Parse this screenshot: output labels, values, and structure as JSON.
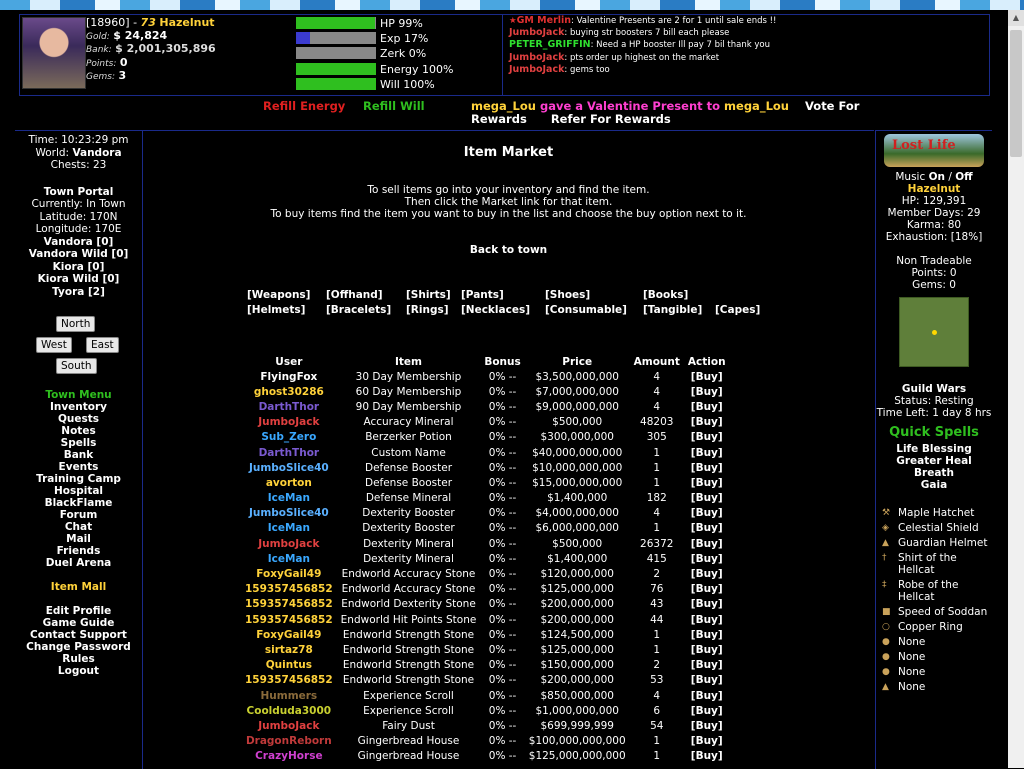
{
  "player": {
    "id": "[18960]",
    "sep": " - ",
    "level": "73",
    "name": "Hazelnut",
    "gold_label": "Gold:",
    "gold": "$ 24,824",
    "bank_label": "Bank:",
    "bank": "$ 2,001,305,896",
    "points_label": "Points:",
    "points": "0",
    "gems_label": "Gems:",
    "gems": "3"
  },
  "bars": [
    {
      "label": "HP 99%",
      "fraction": 0.99,
      "color": "#2fbf1f"
    },
    {
      "label": "Exp 17%",
      "fraction": 0.17,
      "color": "#3b3bd0"
    },
    {
      "label": "Zerk 0%",
      "fraction": 0.0,
      "color": "#2fbf1f"
    },
    {
      "label": "Energy 100%",
      "fraction": 1.0,
      "color": "#2fbf1f"
    },
    {
      "label": "Will 100%",
      "fraction": 1.0,
      "color": "#2fbf1f"
    }
  ],
  "chat": [
    {
      "star": "★",
      "who": "GM Merlin",
      "color": "#e03030",
      "msg": ": Valentine Presents are 2 for 1 until sale ends !!"
    },
    {
      "star": "",
      "who": "JumboJack",
      "color": "#e04040",
      "msg": ": buying str boosters 7 bill each please"
    },
    {
      "star": "",
      "who": "PETER_GRIFFIN",
      "color": "#2fdf2f",
      "msg": ": Need a HP booster Ill pay 7 bil thank you"
    },
    {
      "star": "",
      "who": "JumboJack",
      "color": "#e04040",
      "msg": ": pts order up highest on the market"
    },
    {
      "star": "",
      "who": "JumboJack",
      "color": "#e04040",
      "msg": ": gems too"
    }
  ],
  "links": {
    "refill_energy": "Refill Energy",
    "refill_will": "Refill Will",
    "news_user1": "mega_Lou",
    "news_mid": " gave a Valentine Present to ",
    "news_user2": "mega_Lou",
    "vote": "Vote For Rewards",
    "refer": "Refer For Rewards"
  },
  "left": {
    "time": "Time: 10:23:29 pm",
    "world_label": "World:",
    "world": "Vandora",
    "chests": "Chests: 23",
    "portal": "Town Portal",
    "currently": "Currently: In Town",
    "latitude": "Latitude: 170N",
    "longitude": "Longitude: 170E",
    "locations": [
      "Vandora [0]",
      "Vandora Wild [0]",
      "Kiora [0]",
      "Kiora Wild [0]",
      "Tyora [2]"
    ],
    "nav": {
      "north": "North",
      "west": "West",
      "east": "East",
      "south": "South"
    },
    "menu_title": "Town Menu",
    "menu": [
      "Inventory",
      "Quests",
      "Notes",
      "Spells",
      "Bank",
      "Events",
      "Training Camp",
      "Hospital",
      "BlackFlame",
      "Forum",
      "Chat",
      "Mail",
      "Friends",
      "Duel Arena"
    ],
    "item_mall": "Item Mall",
    "menu2": [
      "Edit Profile",
      "Game Guide",
      "Contact Support",
      "Change Password",
      "Rules",
      "Logout"
    ]
  },
  "market": {
    "title": "Item Market",
    "instr": [
      "To sell items go into your inventory and find the item.",
      "Then click the Market link for that item.",
      "To buy items find the item you want to buy in the list and choose the buy option next to it."
    ],
    "back": "Back to town",
    "categories_row1": [
      "[Weapons]",
      "[Offhand]",
      "[Shirts]",
      "[Pants]",
      "[Shoes]",
      "[Books]"
    ],
    "categories_row2": [
      "[Helmets]",
      "[Bracelets]",
      "[Rings]",
      "[Necklaces]",
      "[Consumable]",
      "[Tangible]",
      "[Capes]"
    ],
    "columns": [
      "User",
      "Item",
      "Bonus",
      "Price",
      "Amount",
      "Action"
    ],
    "rows": [
      {
        "user": "FlyingFox",
        "ucolor": "#ffffff",
        "item": "30 Day Membership",
        "bonus": "0% --",
        "price": "$3,500,000,000",
        "amount": "4",
        "action": "[Buy]"
      },
      {
        "user": "ghost30286",
        "ucolor": "#ffd23a",
        "item": "60 Day Membership",
        "bonus": "0% --",
        "price": "$7,000,000,000",
        "amount": "4",
        "action": "[Buy]"
      },
      {
        "user": "DarthThor",
        "ucolor": "#7a5ad0",
        "item": "90 Day Membership",
        "bonus": "0% --",
        "price": "$9,000,000,000",
        "amount": "4",
        "action": "[Buy]"
      },
      {
        "user": "JumboJack",
        "ucolor": "#e04040",
        "item": "Accuracy Mineral",
        "bonus": "0% --",
        "price": "$500,000",
        "amount": "48203",
        "action": "[Buy]"
      },
      {
        "user": "Sub_Zero",
        "ucolor": "#3aa8ff",
        "item": "Berzerker Potion",
        "bonus": "0% --",
        "price": "$300,000,000",
        "amount": "305",
        "action": "[Buy]"
      },
      {
        "user": "DarthThor",
        "ucolor": "#7a5ad0",
        "item": "Custom Name",
        "bonus": "0% --",
        "price": "$40,000,000,000",
        "amount": "1",
        "action": "[Buy]"
      },
      {
        "user": "JumboSlice40",
        "ucolor": "#5ab0ff",
        "item": "Defense Booster",
        "bonus": "0% --",
        "price": "$10,000,000,000",
        "amount": "1",
        "action": "[Buy]"
      },
      {
        "user": "avorton",
        "ucolor": "#ffd23a",
        "item": "Defense Booster",
        "bonus": "0% --",
        "price": "$15,000,000,000",
        "amount": "1",
        "action": "[Buy]"
      },
      {
        "user": "IceMan",
        "ucolor": "#3aa8ff",
        "item": "Defense Mineral",
        "bonus": "0% --",
        "price": "$1,400,000",
        "amount": "182",
        "action": "[Buy]"
      },
      {
        "user": "JumboSlice40",
        "ucolor": "#5ab0ff",
        "item": "Dexterity Booster",
        "bonus": "0% --",
        "price": "$4,000,000,000",
        "amount": "4",
        "action": "[Buy]"
      },
      {
        "user": "IceMan",
        "ucolor": "#3aa8ff",
        "item": "Dexterity Booster",
        "bonus": "0% --",
        "price": "$6,000,000,000",
        "amount": "1",
        "action": "[Buy]"
      },
      {
        "user": "JumboJack",
        "ucolor": "#e04040",
        "item": "Dexterity Mineral",
        "bonus": "0% --",
        "price": "$500,000",
        "amount": "26372",
        "action": "[Buy]"
      },
      {
        "user": "IceMan",
        "ucolor": "#3aa8ff",
        "item": "Dexterity Mineral",
        "bonus": "0% --",
        "price": "$1,400,000",
        "amount": "415",
        "action": "[Buy]"
      },
      {
        "user": "FoxyGail49",
        "ucolor": "#ffd23a",
        "item": "Endworld Accuracy Stone",
        "bonus": "0% --",
        "price": "$120,000,000",
        "amount": "2",
        "action": "[Buy]"
      },
      {
        "user": "159357456852",
        "ucolor": "#ffd23a",
        "item": "Endworld Accuracy Stone",
        "bonus": "0% --",
        "price": "$125,000,000",
        "amount": "76",
        "action": "[Buy]"
      },
      {
        "user": "159357456852",
        "ucolor": "#ffd23a",
        "item": "Endworld Dexterity Stone",
        "bonus": "0% --",
        "price": "$200,000,000",
        "amount": "43",
        "action": "[Buy]"
      },
      {
        "user": "159357456852",
        "ucolor": "#ffd23a",
        "item": "Endworld Hit Points Stone",
        "bonus": "0% --",
        "price": "$200,000,000",
        "amount": "44",
        "action": "[Buy]"
      },
      {
        "user": "FoxyGail49",
        "ucolor": "#ffd23a",
        "item": "Endworld Strength Stone",
        "bonus": "0% --",
        "price": "$124,500,000",
        "amount": "1",
        "action": "[Buy]"
      },
      {
        "user": "sirtaz78",
        "ucolor": "#ffd23a",
        "item": "Endworld Strength Stone",
        "bonus": "0% --",
        "price": "$125,000,000",
        "amount": "1",
        "action": "[Buy]"
      },
      {
        "user": "Quintus",
        "ucolor": "#ffd23a",
        "item": "Endworld Strength Stone",
        "bonus": "0% --",
        "price": "$150,000,000",
        "amount": "2",
        "action": "[Buy]"
      },
      {
        "user": "159357456852",
        "ucolor": "#ffd23a",
        "item": "Endworld Strength Stone",
        "bonus": "0% --",
        "price": "$200,000,000",
        "amount": "53",
        "action": "[Buy]"
      },
      {
        "user": "Hummers",
        "ucolor": "#8a6a3a",
        "item": "Experience Scroll",
        "bonus": "0% --",
        "price": "$850,000,000",
        "amount": "4",
        "action": "[Buy]"
      },
      {
        "user": "Coolduda3000",
        "ucolor": "#c8d030",
        "item": "Experience Scroll",
        "bonus": "0% --",
        "price": "$1,000,000,000",
        "amount": "6",
        "action": "[Buy]"
      },
      {
        "user": "JumboJack",
        "ucolor": "#e04040",
        "item": "Fairy Dust",
        "bonus": "0% --",
        "price": "$699,999,999",
        "amount": "54",
        "action": "[Buy]"
      },
      {
        "user": "DragonReborn",
        "ucolor": "#c03a3a",
        "item": "Gingerbread House",
        "bonus": "0% --",
        "price": "$100,000,000,000",
        "amount": "1",
        "action": "[Buy]"
      },
      {
        "user": "CrazyHorse",
        "ucolor": "#d040d0",
        "item": "Gingerbread House",
        "bonus": "0% --",
        "price": "$125,000,000,000",
        "amount": "1",
        "action": "[Buy]"
      }
    ]
  },
  "right": {
    "banner_text": "Lost Life",
    "music_label": "Music",
    "music_on": "On",
    "music_sep": " / ",
    "music_off": "Off",
    "name": "Hazelnut",
    "hp": "HP: 129,391",
    "member_days": "Member Days: 29",
    "karma": "Karma: 80",
    "exhaustion": "Exhaustion: [18%]",
    "non_tradeable": "Non Tradeable",
    "nt_points": "Points: 0",
    "nt_gems": "Gems: 0",
    "guild_wars": "Guild Wars",
    "gw_status": "Status: Resting",
    "gw_time": "Time Left: 1 day 8 hrs",
    "quick_spells_title": "Quick Spells",
    "quick_spells": [
      "Life Blessing",
      "Greater Heal",
      "Breath",
      "Gaia"
    ],
    "equipment": [
      {
        "icon": "hatchet-icon",
        "glyph": "⚒",
        "name": "Maple Hatchet"
      },
      {
        "icon": "shield-icon",
        "glyph": "◈",
        "name": "Celestial Shield"
      },
      {
        "icon": "helmet-icon",
        "glyph": "▲",
        "name": "Guardian Helmet"
      },
      {
        "icon": "shirt-icon",
        "glyph": "†",
        "name": "Shirt of the Hellcat"
      },
      {
        "icon": "robe-icon",
        "glyph": "‡",
        "name": "Robe of the Hellcat"
      },
      {
        "icon": "boots-icon",
        "glyph": "■",
        "name": "Speed of Soddan"
      },
      {
        "icon": "ring-icon",
        "glyph": "○",
        "name": "Copper Ring"
      },
      {
        "icon": "bracelet-icon",
        "glyph": "●",
        "name": "None"
      },
      {
        "icon": "necklace-icon",
        "glyph": "●",
        "name": "None"
      },
      {
        "icon": "tangible-icon",
        "glyph": "●",
        "name": "None"
      },
      {
        "icon": "cape-icon",
        "glyph": "▲",
        "name": "None"
      }
    ]
  }
}
